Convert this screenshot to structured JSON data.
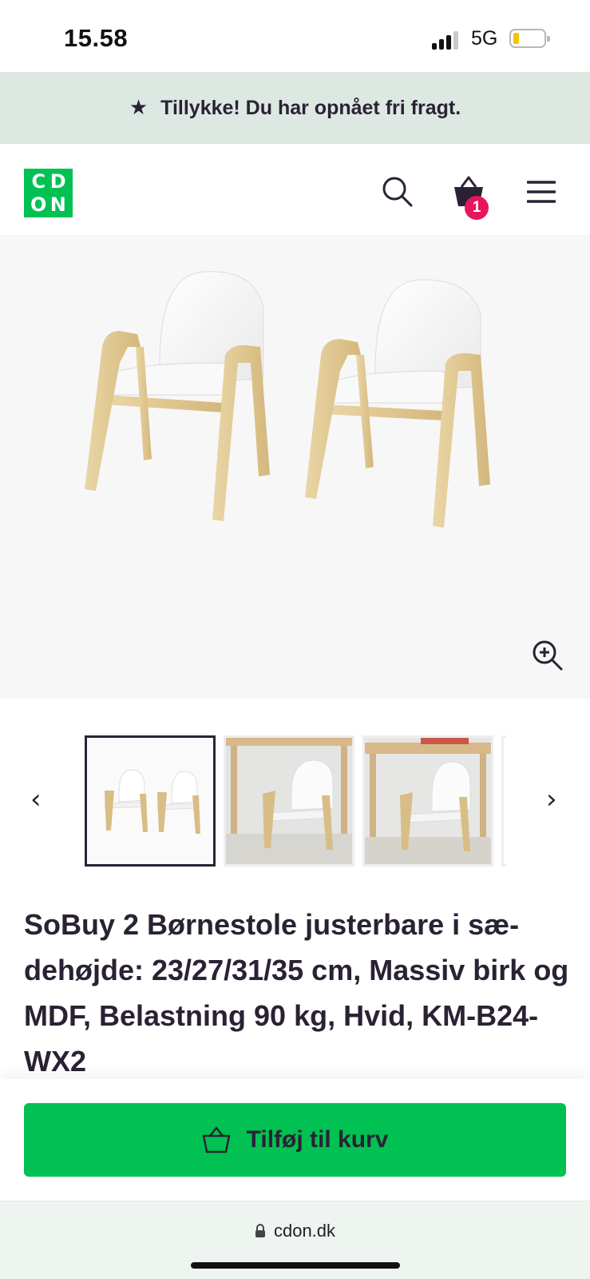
{
  "status": {
    "time": "15.58",
    "network": "5G"
  },
  "banner": {
    "text": "Tillykke! Du har opnået fri fragt."
  },
  "header": {
    "logo_letters": [
      "C",
      "D",
      "O",
      "N"
    ],
    "cart_count": "1"
  },
  "product": {
    "title": "SoBuy 2 Børnestole justerbare i sæ-dehøjde: 23/27/31/35 cm, Massiv birk og MDF, Belastning 90 kg, Hvid, KM-B24-WX2",
    "thumbnails_selected": 0
  },
  "cta": {
    "label": "Tilføj til kurv"
  },
  "url_bar": {
    "domain": "cdon.dk"
  },
  "colors": {
    "brand_green": "#00c152",
    "badge_pink": "#e8155c",
    "dark_text": "#2a2234",
    "banner_bg": "#dde8e2"
  },
  "icons": [
    "star-icon",
    "search-icon",
    "basket-icon",
    "menu-icon",
    "zoom-in-icon",
    "chevron-left-icon",
    "chevron-right-icon",
    "lock-icon"
  ]
}
